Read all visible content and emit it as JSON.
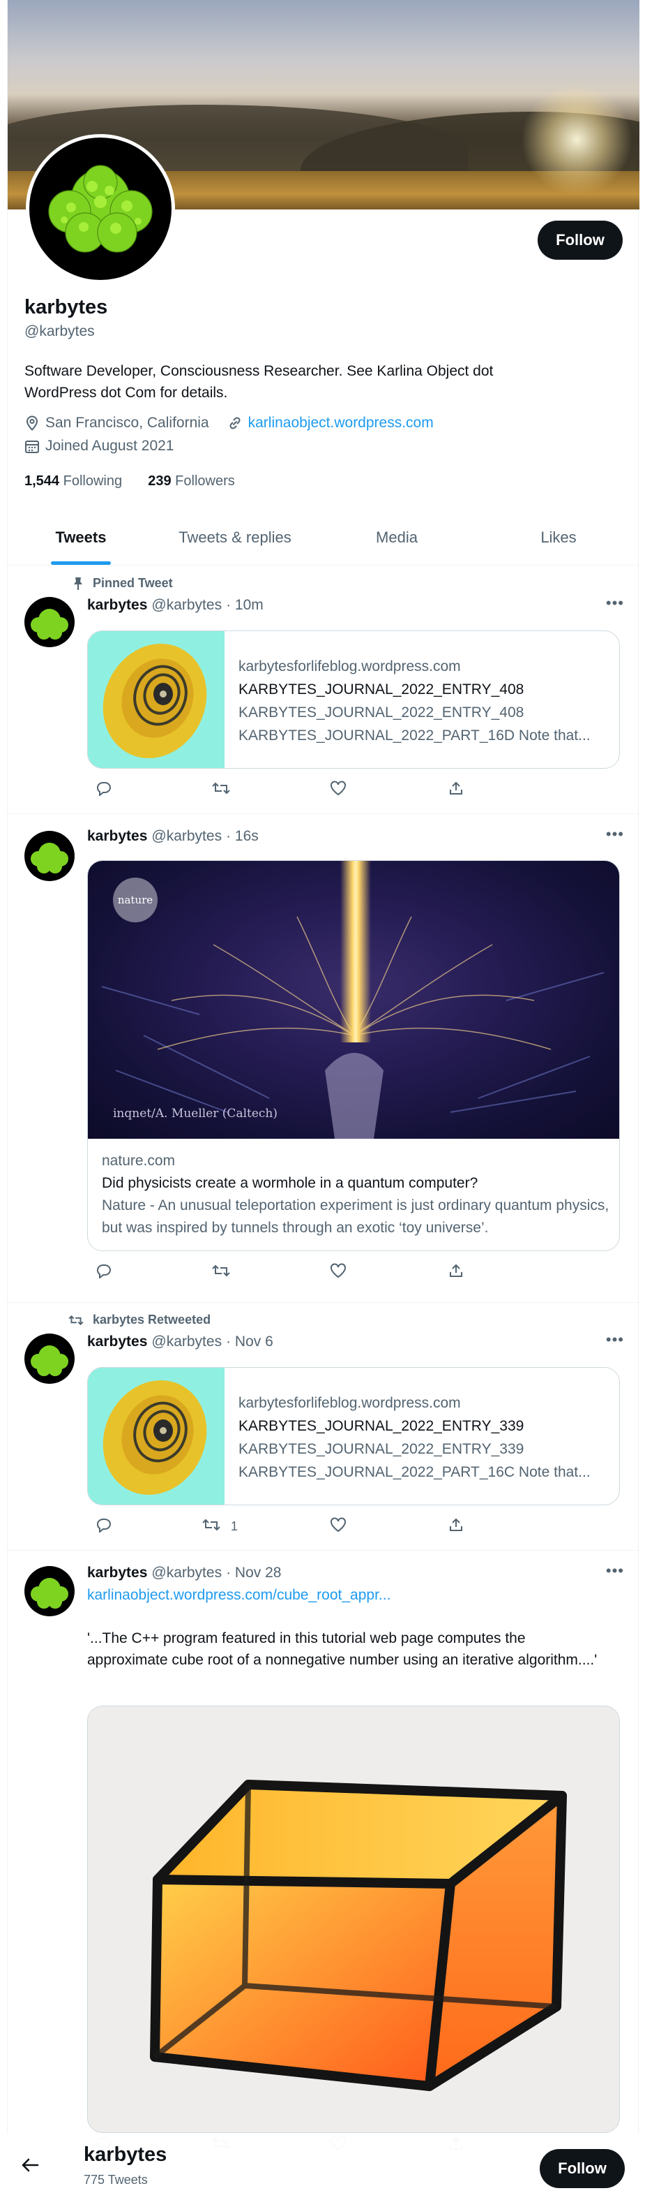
{
  "profile": {
    "name": "karbytes",
    "handle": "@karbytes",
    "follow_label": "Follow",
    "bio": "Software Developer, Consciousness Researcher. See Karlina Object dot WordPress dot Com for details.",
    "location": "San Francisco, California",
    "website": "karlinaobject.wordpress.com",
    "joined": "Joined August 2021",
    "following_count": "1,544",
    "following_label": "Following",
    "followers_count": "239",
    "followers_label": "Followers"
  },
  "tabs": [
    "Tweets",
    "Tweets & replies",
    "Media",
    "Likes"
  ],
  "icons": {
    "location": "location-pin-icon",
    "link": "link-icon",
    "calendar": "calendar-icon",
    "pin": "pin-icon",
    "retweet": "retweet-icon",
    "reply": "reply-icon",
    "like": "heart-icon",
    "share": "share-icon",
    "more": "more-icon",
    "back": "back-arrow-icon"
  },
  "tweets": [
    {
      "context": "Pinned Tweet",
      "name": "karbytes",
      "handle": "@karbytes",
      "time": "· 10m",
      "card": {
        "domain": "karbytesforlifeblog.wordpress.com",
        "title": "KARBYTES_JOURNAL_2022_ENTRY_408",
        "desc1": "KARBYTES_JOURNAL_2022_ENTRY_408",
        "desc2": "KARBYTES_JOURNAL_2022_PART_16D Note that..."
      },
      "retweets": ""
    },
    {
      "name": "karbytes",
      "handle": "@karbytes",
      "time": "· 16s",
      "card": {
        "badge": "nature",
        "credit": "inqnet/A. Mueller (Caltech)",
        "domain": "nature.com",
        "title": "Did physicists create a wormhole in a quantum computer?",
        "desc": "Nature - An unusual teleportation experiment is just ordinary quantum physics, but was inspired by tunnels through an exotic ‘toy universe’."
      }
    },
    {
      "context": "karbytes Retweeted",
      "name": "karbytes",
      "handle": "@karbytes",
      "time": "· Nov 6",
      "card": {
        "domain": "karbytesforlifeblog.wordpress.com",
        "title": "KARBYTES_JOURNAL_2022_ENTRY_339",
        "desc1": "KARBYTES_JOURNAL_2022_ENTRY_339",
        "desc2": "KARBYTES_JOURNAL_2022_PART_16C Note that..."
      },
      "retweets": "1"
    },
    {
      "name": "karbytes",
      "handle": "@karbytes",
      "time": "· Nov 28",
      "link": "karlinaobject.wordpress.com/cube_root_appr...",
      "text": "'...The C++ program featured in this tutorial web page computes the approximate cube root of a nonnegative number using an iterative algorithm....'"
    }
  ],
  "bottom_bar": {
    "name": "karbytes",
    "count": "775 Tweets",
    "follow_label": "Follow"
  },
  "colors": {
    "accent": "#1d9bf0",
    "text": "#0f1419",
    "muted": "#536471",
    "button": "#0f1419"
  }
}
